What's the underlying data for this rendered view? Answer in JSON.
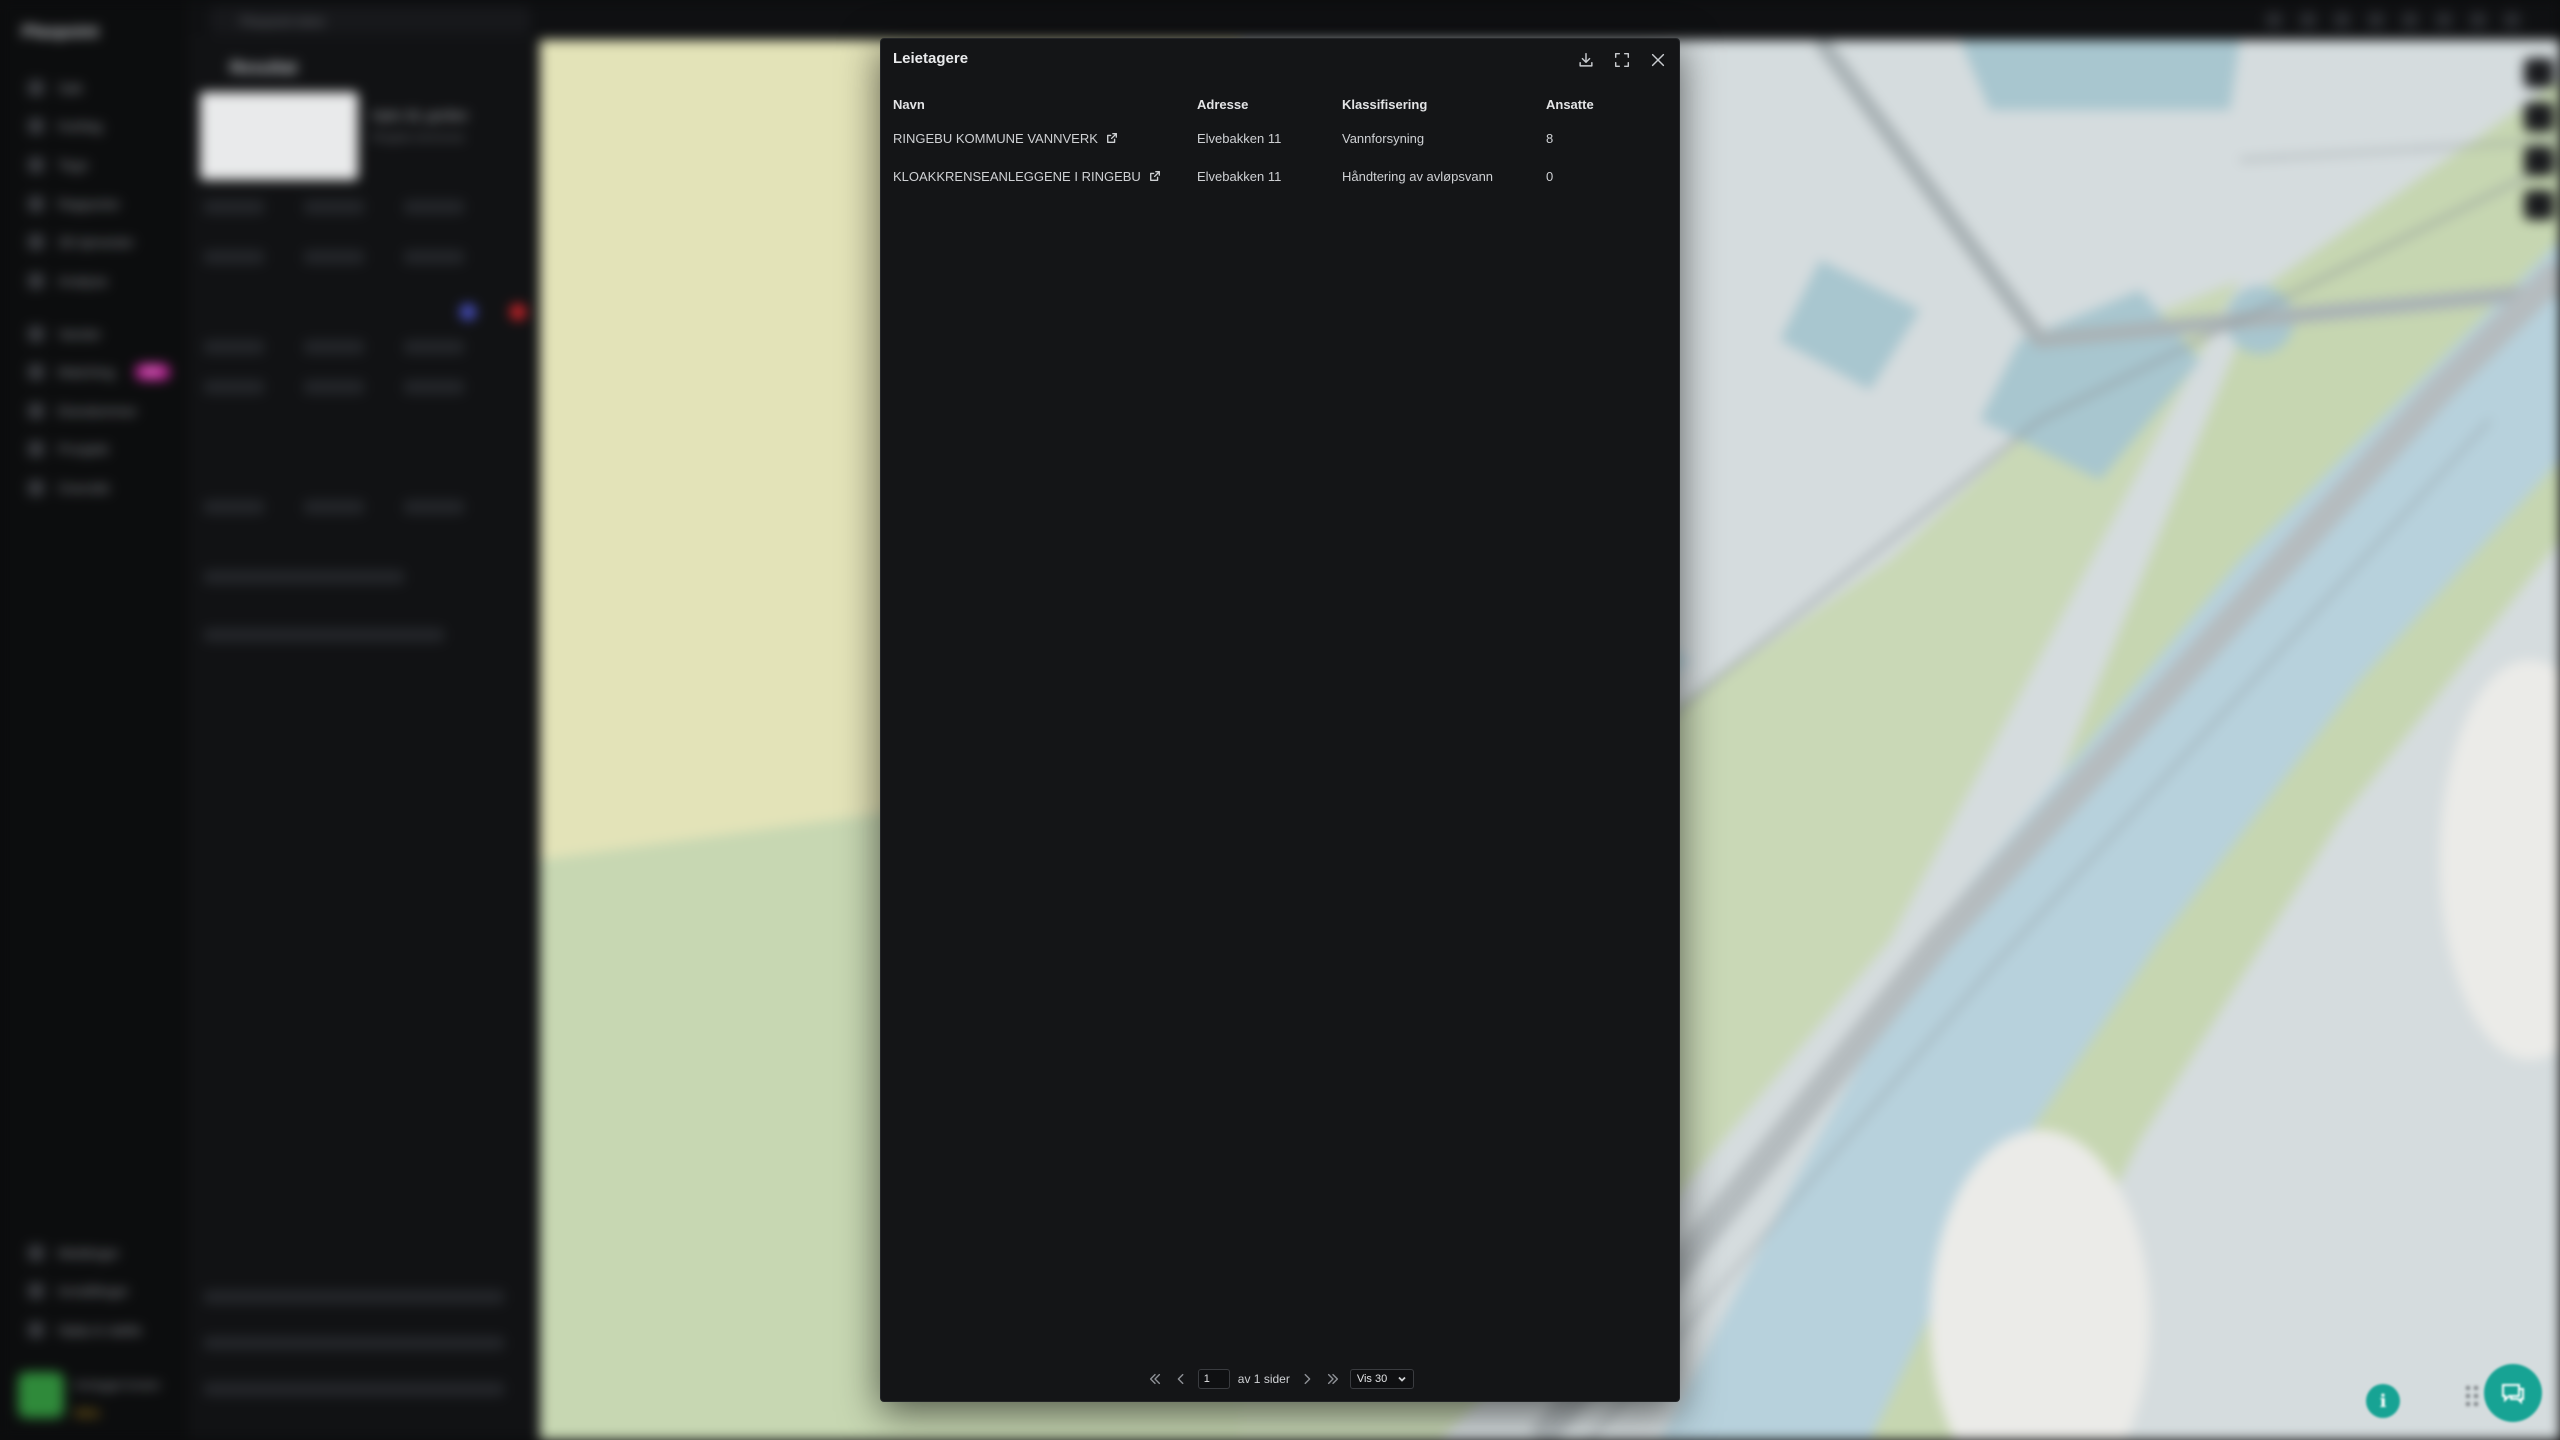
{
  "app": {
    "brand": "Plaxpoint",
    "search_placeholder": "Plaxpoint tekst",
    "nav_items": [
      {
        "label": "Søk",
        "icon": "search-icon"
      },
      {
        "label": "Kartlag",
        "icon": "layers-icon"
      },
      {
        "label": "Tegn",
        "icon": "pen-icon"
      },
      {
        "label": "Rapporter",
        "icon": "report-icon"
      },
      {
        "label": "3D-tjenester",
        "icon": "cube-icon"
      },
      {
        "label": "Analyse",
        "icon": "chart-icon"
      },
      {
        "label": "Varsler",
        "icon": "bell-icon"
      },
      {
        "label": "Matching",
        "icon": "match-icon",
        "badge": "NY"
      },
      {
        "label": "Eiendommer",
        "icon": "building-icon"
      },
      {
        "label": "Prosjekt",
        "icon": "folder-icon"
      },
      {
        "label": "Oversikt",
        "icon": "grid-icon"
      }
    ],
    "nav_bottom": [
      {
        "label": "Meldinger",
        "icon": "message-icon"
      },
      {
        "label": "Innstillinger",
        "icon": "gear-icon"
      },
      {
        "label": "Hjelp & støtte",
        "icon": "help-icon"
      }
    ],
    "user": {
      "name": "Innlogget bruker",
      "status": "Aktiv"
    },
    "side_panel": {
      "title": "Resultat",
      "property_name": "Hylm 33, gnr/bnr",
      "property_sub": "Ringebu kommune"
    }
  },
  "modal": {
    "title": "Leietagere",
    "columns": [
      "Navn",
      "Adresse",
      "Klassifisering",
      "Ansatte"
    ],
    "rows": [
      {
        "name": "RINGEBU KOMMUNE VANNVERK",
        "address": "Elvebakken 11",
        "classification": "Vannforsyning",
        "employees": "8"
      },
      {
        "name": "KLOAKKRENSEANLEGGENE I RINGEBU",
        "address": "Elvebakken 11",
        "classification": "Håndtering av avløpsvann",
        "employees": "0"
      }
    ],
    "pager": {
      "current_page": "1",
      "of_label": "av 1 sider",
      "page_size": "Vis 30"
    }
  },
  "colors": {
    "accent": "#17a394",
    "modal_bg": "#141517",
    "map_water": "#b9d3dd",
    "map_green": "#c4d7b0"
  }
}
